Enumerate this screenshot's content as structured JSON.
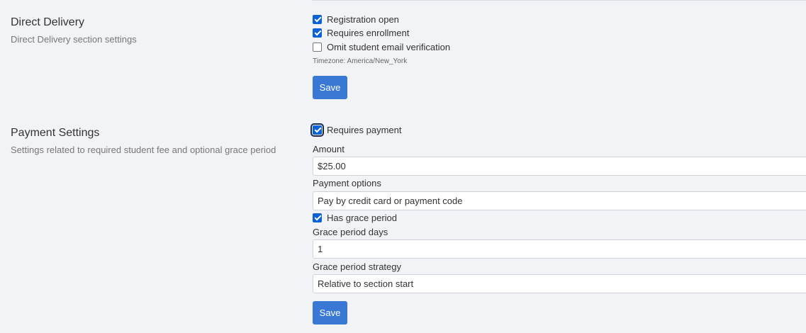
{
  "direct_delivery": {
    "title": "Direct Delivery",
    "description": "Direct Delivery section settings",
    "options": [
      {
        "label": "Registration open",
        "checked": true
      },
      {
        "label": "Requires enrollment",
        "checked": true
      },
      {
        "label": "Omit student email verification",
        "checked": false
      }
    ],
    "timezone": "Timezone: America/New_York",
    "save_label": "Save"
  },
  "payment_settings": {
    "title": "Payment Settings",
    "description": "Settings related to required student fee and optional grace period",
    "requires_payment_label": "Requires payment",
    "requires_payment_checked": true,
    "amount_label": "Amount",
    "amount_value": "$25.00",
    "payment_options_label": "Payment options",
    "payment_options_value": "Pay by credit card or payment code",
    "grace_period_label": "Has grace period",
    "grace_period_checked": true,
    "grace_days_label": "Grace period days",
    "grace_days_value": "1",
    "grace_strategy_label": "Grace period strategy",
    "grace_strategy_value": "Relative to section start",
    "save_label": "Save"
  },
  "colors": {
    "accent": "#3a78d6",
    "checkbox": "#0b62d6",
    "background": "#f2f3f6"
  },
  "icons": [
    "checkmark-icon"
  ]
}
